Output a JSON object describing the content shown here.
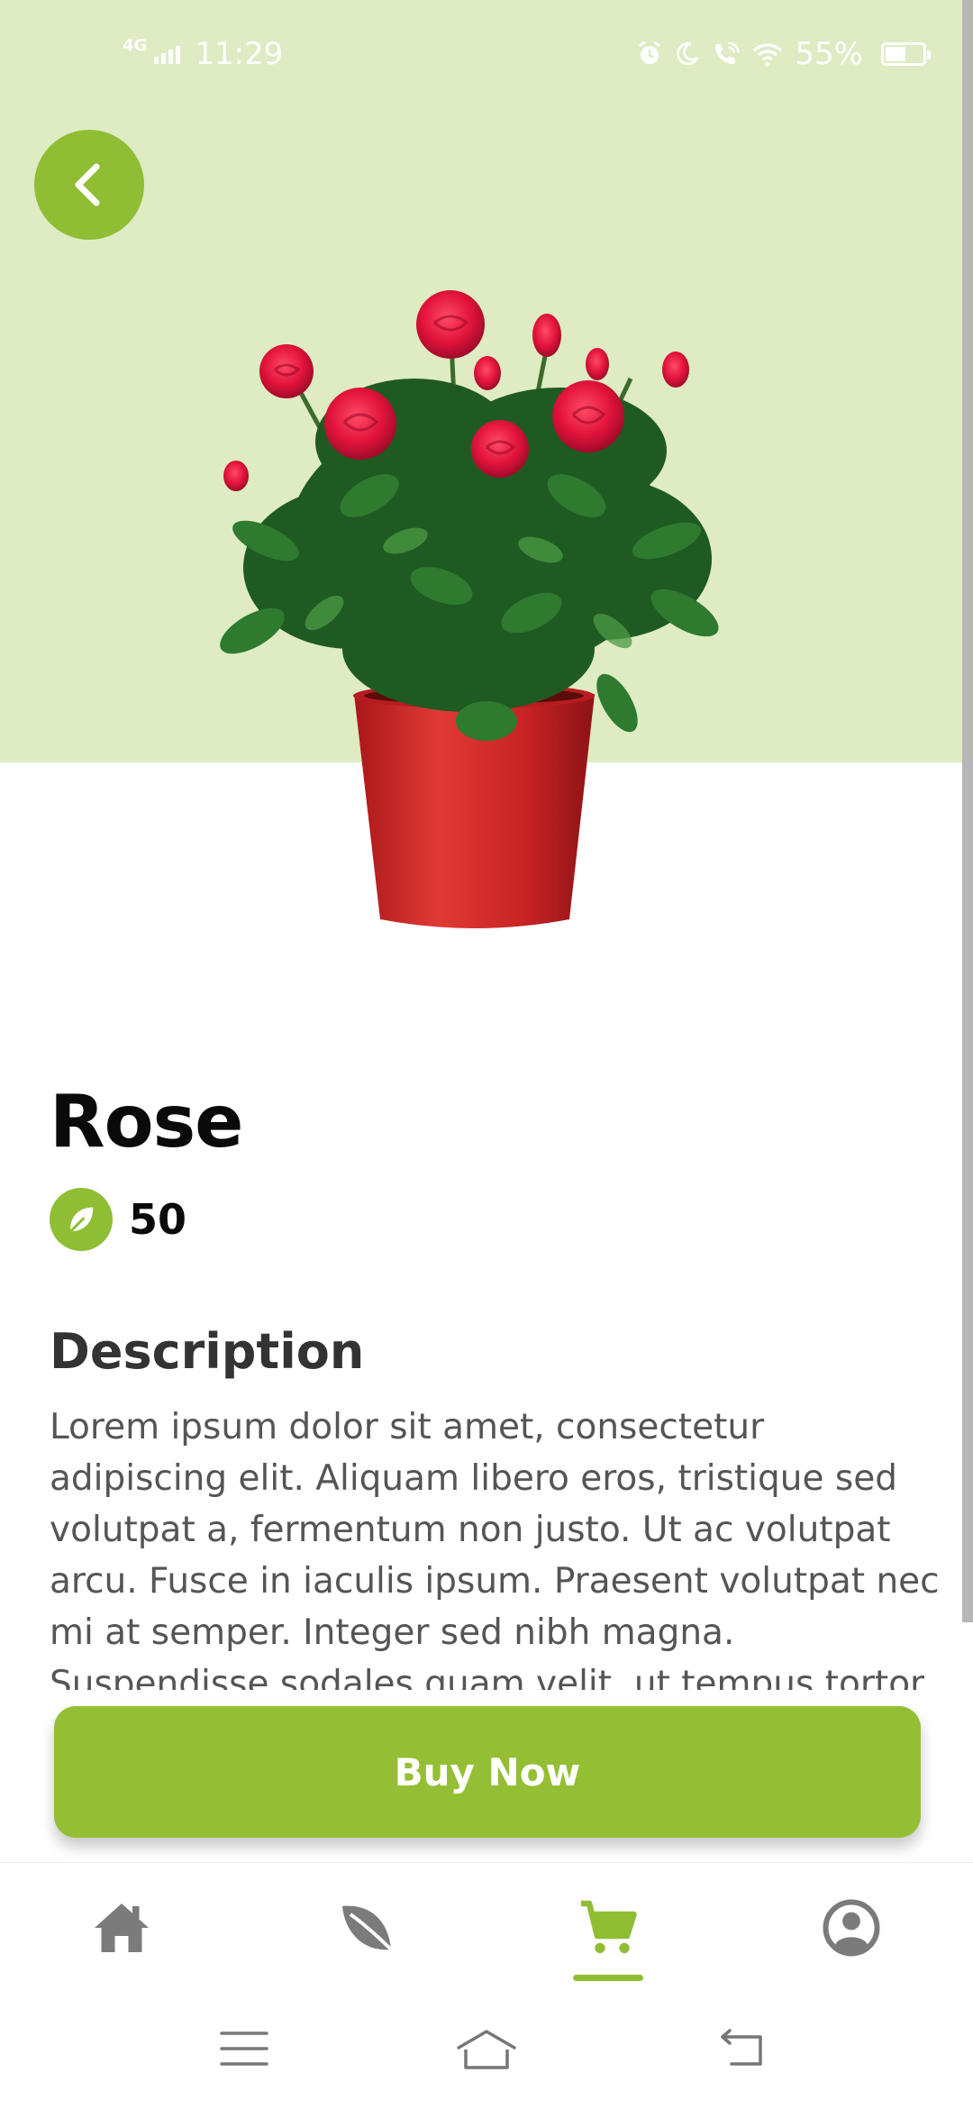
{
  "status_bar": {
    "network": "4G",
    "time": "11:29",
    "battery_percent": "55%",
    "battery_level": 0.55,
    "icons": [
      "alarm-icon",
      "moon-icon",
      "wifi-calling-icon",
      "wifi-icon",
      "battery-icon"
    ]
  },
  "product": {
    "name": "Rose",
    "price": "50",
    "image": "potted-red-rose-plant"
  },
  "description": {
    "heading": "Description",
    "body": "Lorem ipsum dolor sit amet, consectetur adipiscing elit. Aliquam libero eros, tristique sed volutpat a, fermentum non justo. Ut ac volutpat arcu. Fusce in iaculis ipsum. Praesent volutpat nec mi at semper. Integer sed nibh magna. Suspendisse sodales quam velit, ut tempus tortor scelerisque sed."
  },
  "actions": {
    "buy_label": "Buy Now"
  },
  "bottom_nav": {
    "items": [
      {
        "icon": "home-icon",
        "active": false
      },
      {
        "icon": "leaf-icon",
        "active": false
      },
      {
        "icon": "cart-icon",
        "active": true
      },
      {
        "icon": "profile-icon",
        "active": false
      }
    ]
  },
  "colors": {
    "accent": "#8fbe35",
    "hero_background": "#deebc3",
    "inactive_icon": "#7b7b7b"
  }
}
